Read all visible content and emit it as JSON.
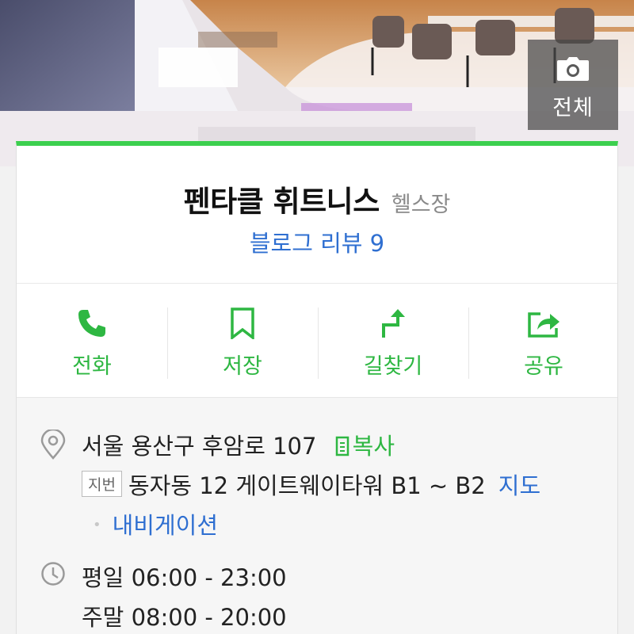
{
  "hero": {
    "photo_badge_label": "전체",
    "camera_icon": "camera-icon"
  },
  "place": {
    "name": "펜타클 휘트니스",
    "category": "헬스장",
    "review_link": "블로그 리뷰 9"
  },
  "actions": [
    {
      "label": "전화",
      "icon": "phone-icon"
    },
    {
      "label": "저장",
      "icon": "bookmark-icon"
    },
    {
      "label": "길찾기",
      "icon": "directions-icon"
    },
    {
      "label": "공유",
      "icon": "share-icon"
    }
  ],
  "address": {
    "road": "서울 용산구 후암로 107",
    "copy_label": "복사",
    "jibeon_tag": "지번",
    "jibeon": "동자동 12 게이트웨이타워 B1 ~ B2",
    "map_link": "지도",
    "navigation_link": "내비게이션"
  },
  "hours": {
    "weekday": "평일 06:00 - 23:00",
    "weekend": "주말 08:00 - 20:00"
  },
  "colors": {
    "accent_green": "#3ccf4e",
    "link_blue": "#2f6fd1"
  }
}
